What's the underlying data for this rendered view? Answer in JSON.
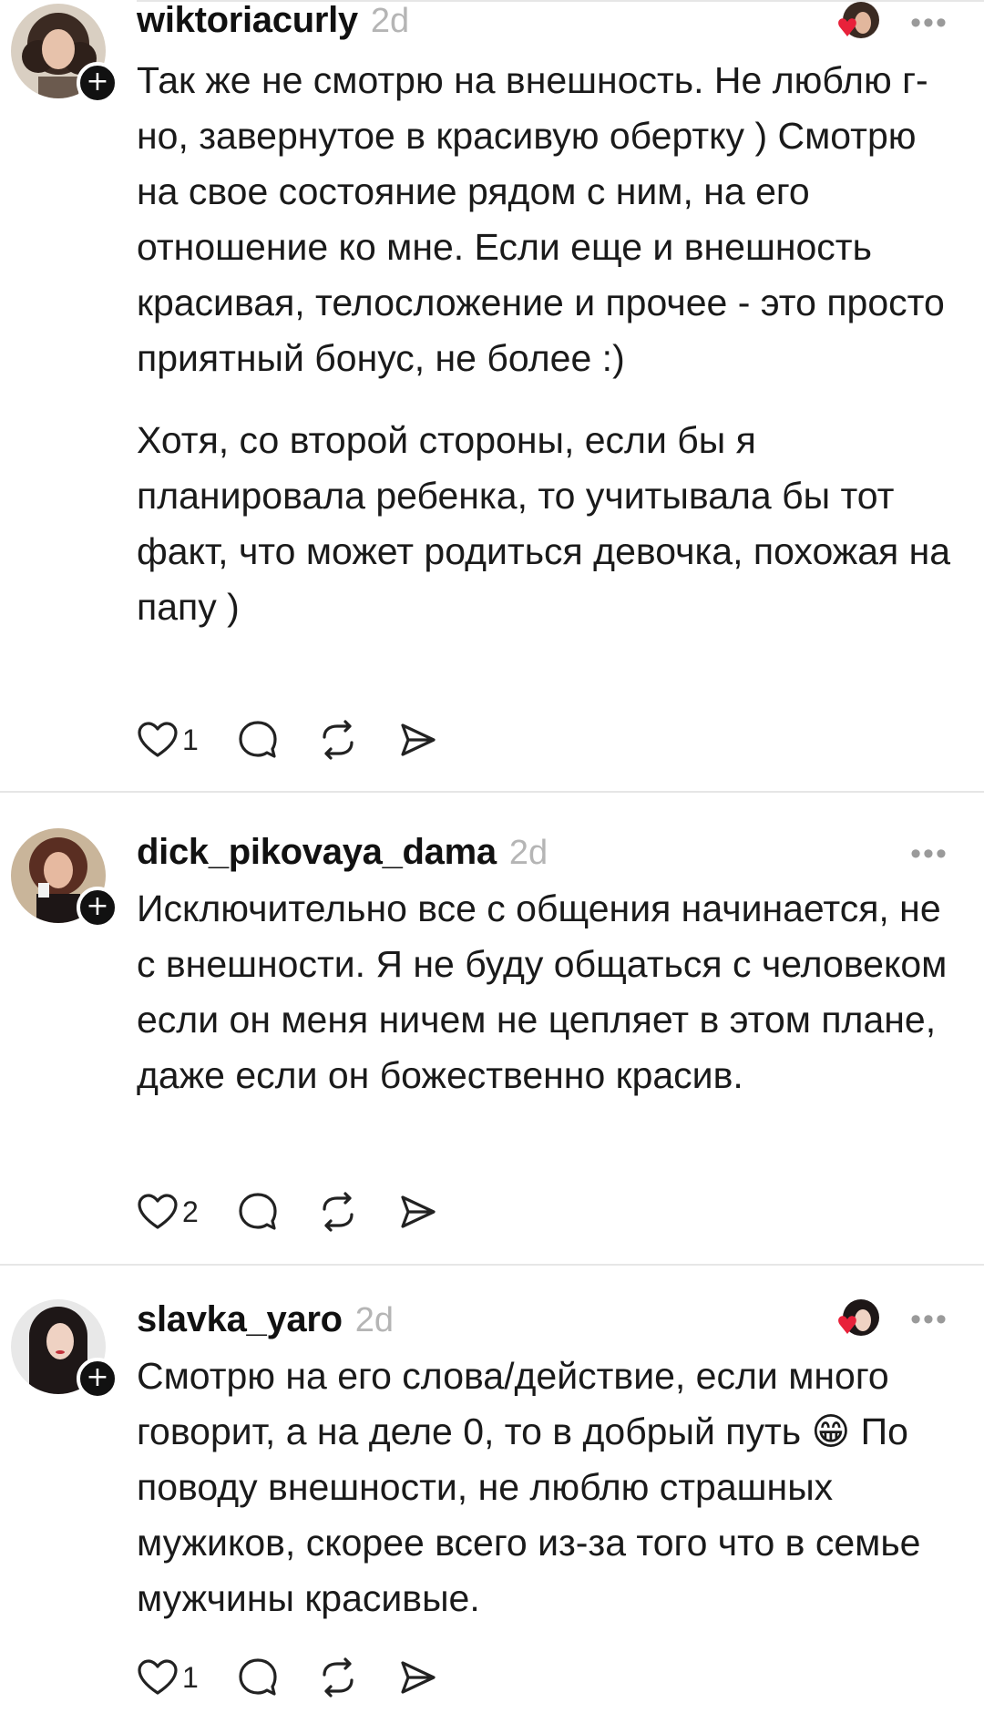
{
  "posts": [
    {
      "username": "wiktoriacurly",
      "time": "2d",
      "paragraphs": [
        "Так же не смотрю на внешность. Не люблю г-но, завернутое в красивую обертку ) Смотрю на свое состояние рядом с ним, на его отношение ко мне. Если еще и внешность красивая, телосложение и прочее - это просто приятный бонус, не более :)",
        "Хотя, со второй стороны, если бы я планировала ребенка, то учитывала бы тот факт, что может родиться девочка, похожая на папу )"
      ],
      "likes": "1",
      "liked_by_author": true,
      "more_icon": "ellipsis-icon"
    },
    {
      "username": "dick_pikovaya_dama",
      "time": "2d",
      "paragraphs": [
        "Исключительно все с общения начинается, не с внешности. Я не буду общаться с человеком если он меня ничем не цепляет в этом плане, даже если он божественно красив."
      ],
      "likes": "2",
      "liked_by_author": false,
      "more_icon": "ellipsis-icon"
    },
    {
      "username": "slavka_yaro",
      "time": "2d",
      "paragraphs": [
        "Смотрю на его слова/действие, если много говорит, а на деле 0, то в добрый путь 😁 По поводу внешности, не люблю страшных мужиков, скорее всего из-за того что в семье мужчины красивые."
      ],
      "likes": "1",
      "liked_by_author": true,
      "more_icon": "ellipsis-icon"
    }
  ],
  "icons": {
    "like": "heart-outline-icon",
    "reply": "comment-bubble-icon",
    "repost": "repost-arrows-icon",
    "share": "send-paper-plane-icon",
    "follow": "plus-icon"
  },
  "colors": {
    "text": "#1a1a1a",
    "muted": "#b5b5b5",
    "divider": "#e6e6e6",
    "heart_red": "#e8213a"
  }
}
